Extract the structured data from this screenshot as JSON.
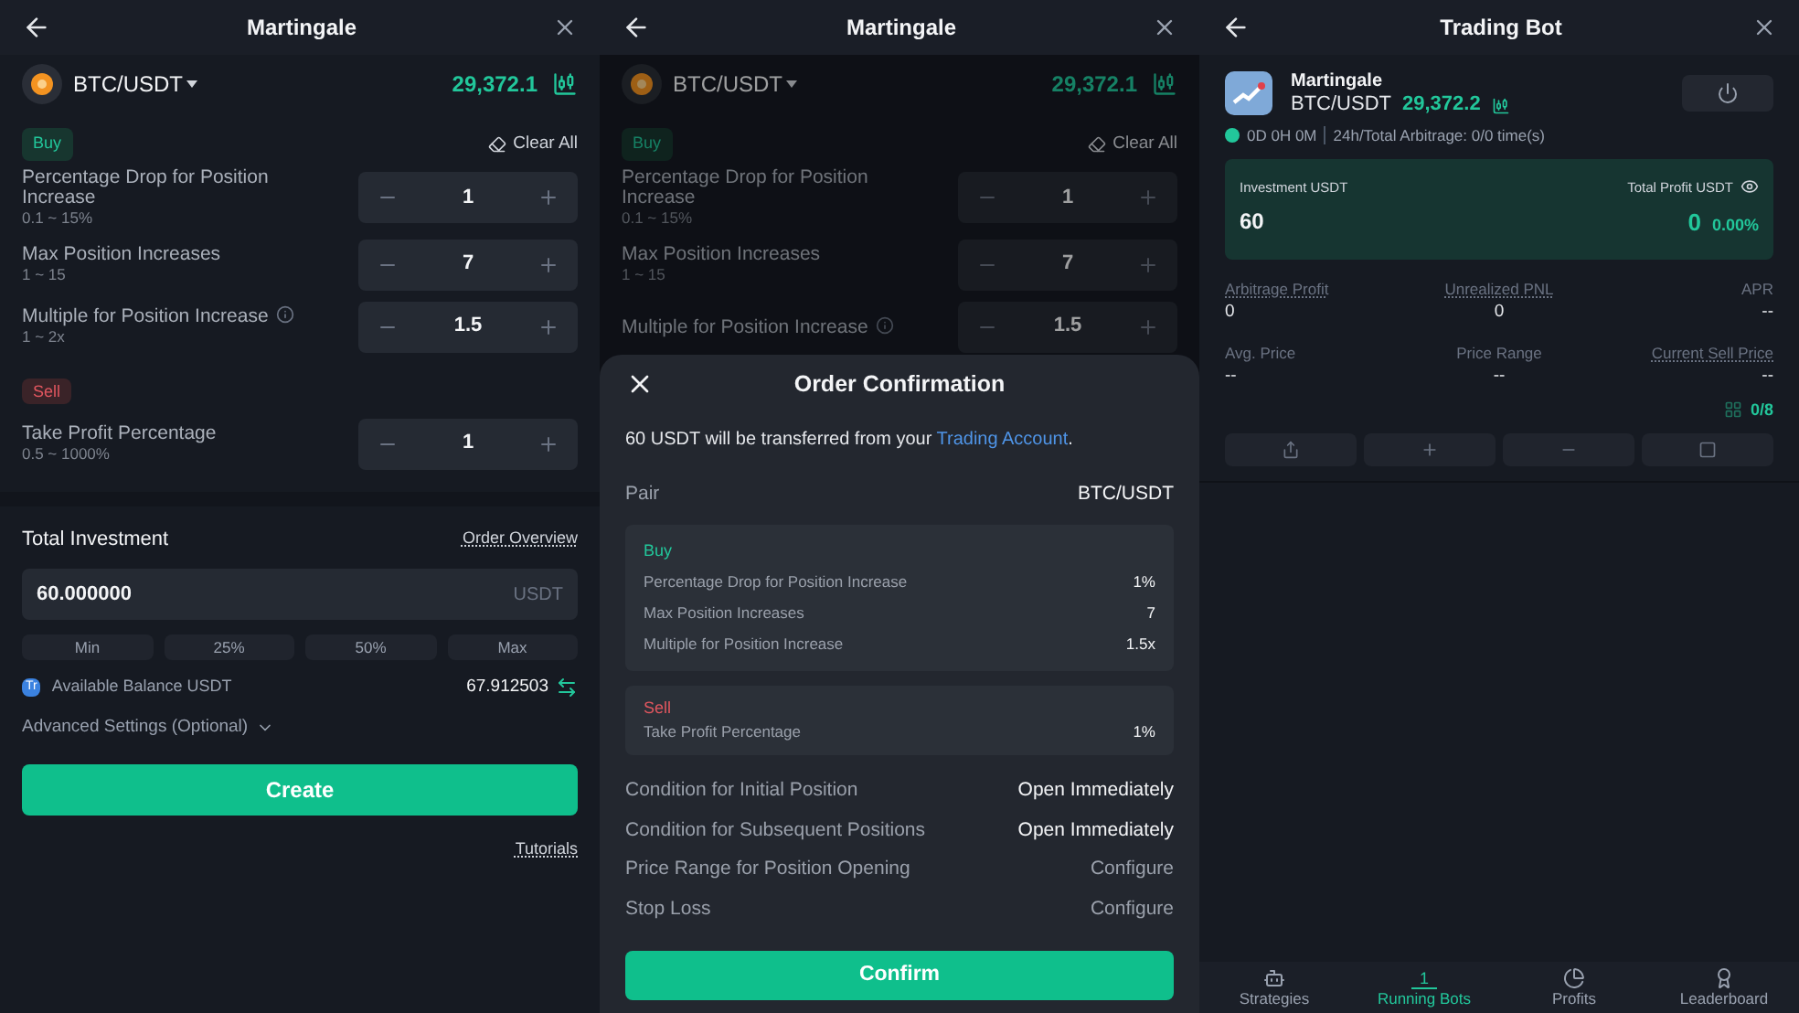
{
  "setup_screen": {
    "header": {
      "title": "Martingale"
    },
    "pair": "BTC/USDT",
    "price": "29,372.1",
    "buy_tag": "Buy",
    "clear_all": "Clear All",
    "sell_tag": "Sell",
    "buy_params": [
      {
        "label": "Percentage Drop for Position Increase",
        "hint": "0.1 ~ 15%",
        "value": "1",
        "info": false
      },
      {
        "label": "Max Position Increases",
        "hint": "1 ~ 15",
        "value": "7",
        "info": false
      },
      {
        "label": "Multiple for Position Increase",
        "hint": "1 ~ 2x",
        "value": "1.5",
        "info": true
      }
    ],
    "sell_params": [
      {
        "label": "Take Profit Percentage",
        "hint": "0.5 ~ 1000%",
        "value": "1",
        "info": false
      }
    ],
    "investment": {
      "label": "Total Investment",
      "overview_link": "Order Overview",
      "value": "60.000000",
      "unit": "USDT",
      "quick_amounts": [
        "Min",
        "25%",
        "50%",
        "Max"
      ],
      "account_badge": "Tr",
      "balance_label": "Available Balance USDT",
      "balance": "67.912503"
    },
    "advanced_settings": "Advanced Settings (Optional)",
    "create_button": "Create",
    "tutorials_link": "Tutorials"
  },
  "confirm_screen": {
    "header": {
      "title": "Martingale"
    },
    "background": {
      "pair": "BTC/USDT",
      "price": "29,372.1",
      "buy_tag": "Buy",
      "clear_all": "Clear All",
      "buy_params": [
        {
          "label": "Percentage Drop for Position Increase",
          "hint": "0.1 ~ 15%",
          "value": "1",
          "info": false
        },
        {
          "label": "Max Position Increases",
          "hint": "1 ~ 15",
          "value": "7",
          "info": false
        },
        {
          "label": "Multiple for Position Increase",
          "value": "1.5",
          "info": true
        }
      ]
    },
    "sheet": {
      "title": "Order Confirmation",
      "message": "60 USDT will be transferred from your ",
      "message_link": "Trading Account",
      "message_end": ".",
      "pair_label": "Pair",
      "pair_value": "BTC/USDT",
      "buy_box": {
        "tag": "Buy",
        "rows": [
          {
            "label": "Percentage Drop for Position Increase",
            "value": "1%"
          },
          {
            "label": "Max Position Increases",
            "value": "7"
          },
          {
            "label": "Multiple for Position Increase",
            "value": "1.5x"
          }
        ]
      },
      "sell_box": {
        "tag": "Sell",
        "rows": [
          {
            "label": "Take Profit Percentage",
            "value": "1%"
          }
        ]
      },
      "conditions": [
        {
          "label": "Condition for Initial Position",
          "value": "Open Immediately",
          "emphasis": true
        },
        {
          "label": "Condition for Subsequent Positions",
          "value": "Open Immediately",
          "emphasis": true
        },
        {
          "label": "Price Range for Position Opening",
          "value": "Configure",
          "emphasis": false
        },
        {
          "label": "Stop Loss",
          "value": "Configure",
          "emphasis": false
        }
      ],
      "confirm_button": "Confirm"
    }
  },
  "bot_screen": {
    "header": {
      "title": "Trading Bot"
    },
    "bot_name": "Martingale",
    "pair": "BTC/USDT",
    "price": "29,372.2",
    "running": true,
    "runtime": "0D 0H 0M",
    "arbitrage": "24h/Total Arbitrage: 0/0 time(s)",
    "summary": {
      "investment_label": "Investment USDT",
      "investment": "60",
      "profit_label": "Total Profit USDT",
      "profit": "0",
      "profit_pct": "0.00%"
    },
    "stats": [
      {
        "label": "Arbitrage Profit",
        "value": "0",
        "underlined": true
      },
      {
        "label": "Unrealized PNL",
        "value": "0",
        "underlined": true
      },
      {
        "label": "APR",
        "value": "--",
        "underlined": false
      },
      {
        "label": "Avg. Price",
        "value": "--",
        "underlined": false
      },
      {
        "label": "Price Range",
        "value": "--",
        "underlined": false
      },
      {
        "label": "Current Sell Price",
        "value": "--",
        "underlined": true
      }
    ],
    "orders": "0/8",
    "nav": [
      {
        "label": "Strategies",
        "selected": false
      },
      {
        "label": "Running Bots",
        "selected": true,
        "badge": "1"
      },
      {
        "label": "Profits",
        "selected": false
      },
      {
        "label": "Leaderboard",
        "selected": false
      }
    ]
  }
}
